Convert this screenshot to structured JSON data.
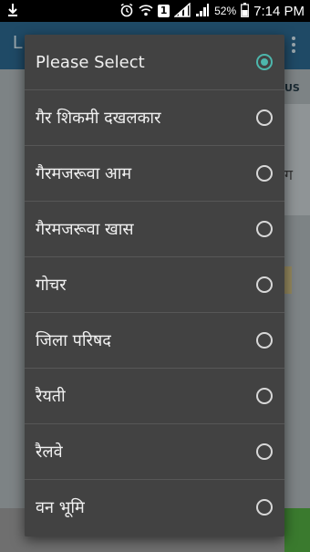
{
  "status_bar": {
    "download_icon": "download-icon",
    "sim_number": "1",
    "battery_percent": "52%",
    "time": "7:14 PM"
  },
  "background_app": {
    "title_fragment": "L",
    "tag_fragment": "US",
    "card_fragment": "ग"
  },
  "dialog": {
    "selected_index": 0,
    "options": [
      {
        "label": "Please Select",
        "selected": true
      },
      {
        "label": "गैर शिकमी दखलकार",
        "selected": false
      },
      {
        "label": "गैरमजरूवा आम",
        "selected": false
      },
      {
        "label": "गैरमजरूवा खास",
        "selected": false
      },
      {
        "label": "गोचर",
        "selected": false
      },
      {
        "label": "जिला परिषद",
        "selected": false
      },
      {
        "label": "रैयती",
        "selected": false
      },
      {
        "label": "रैलवे",
        "selected": false
      },
      {
        "label": "वन भूमि",
        "selected": false
      }
    ]
  },
  "colors": {
    "accent": "#4db6ac",
    "dialog_bg": "#424242",
    "app_bar": "#1f4a66"
  }
}
